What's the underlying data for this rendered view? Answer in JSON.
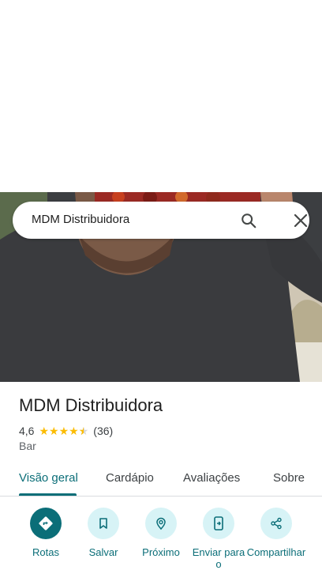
{
  "search": {
    "query": "MDM Distribuidora"
  },
  "place": {
    "name": "MDM Distribuidora",
    "rating": "4,6",
    "rating_value": 4.6,
    "review_count": "(36)",
    "category": "Bar"
  },
  "tabs": [
    {
      "label": "Visão geral",
      "active": true
    },
    {
      "label": "Cardápio"
    },
    {
      "label": "Avaliações"
    },
    {
      "label": "Sobre"
    }
  ],
  "actions": [
    {
      "label": "Rotas",
      "icon": "directions-icon"
    },
    {
      "label": "Salvar",
      "icon": "bookmark-icon"
    },
    {
      "label": "Próximo",
      "icon": "nearby-icon"
    },
    {
      "label": "Enviar para o",
      "icon": "send-to-phone-icon"
    },
    {
      "label": "Compartilhar",
      "icon": "share-icon"
    }
  ],
  "colors": {
    "accent": "#0b6e78",
    "accent_light": "#d7f3f6",
    "star": "#fbbc04"
  }
}
